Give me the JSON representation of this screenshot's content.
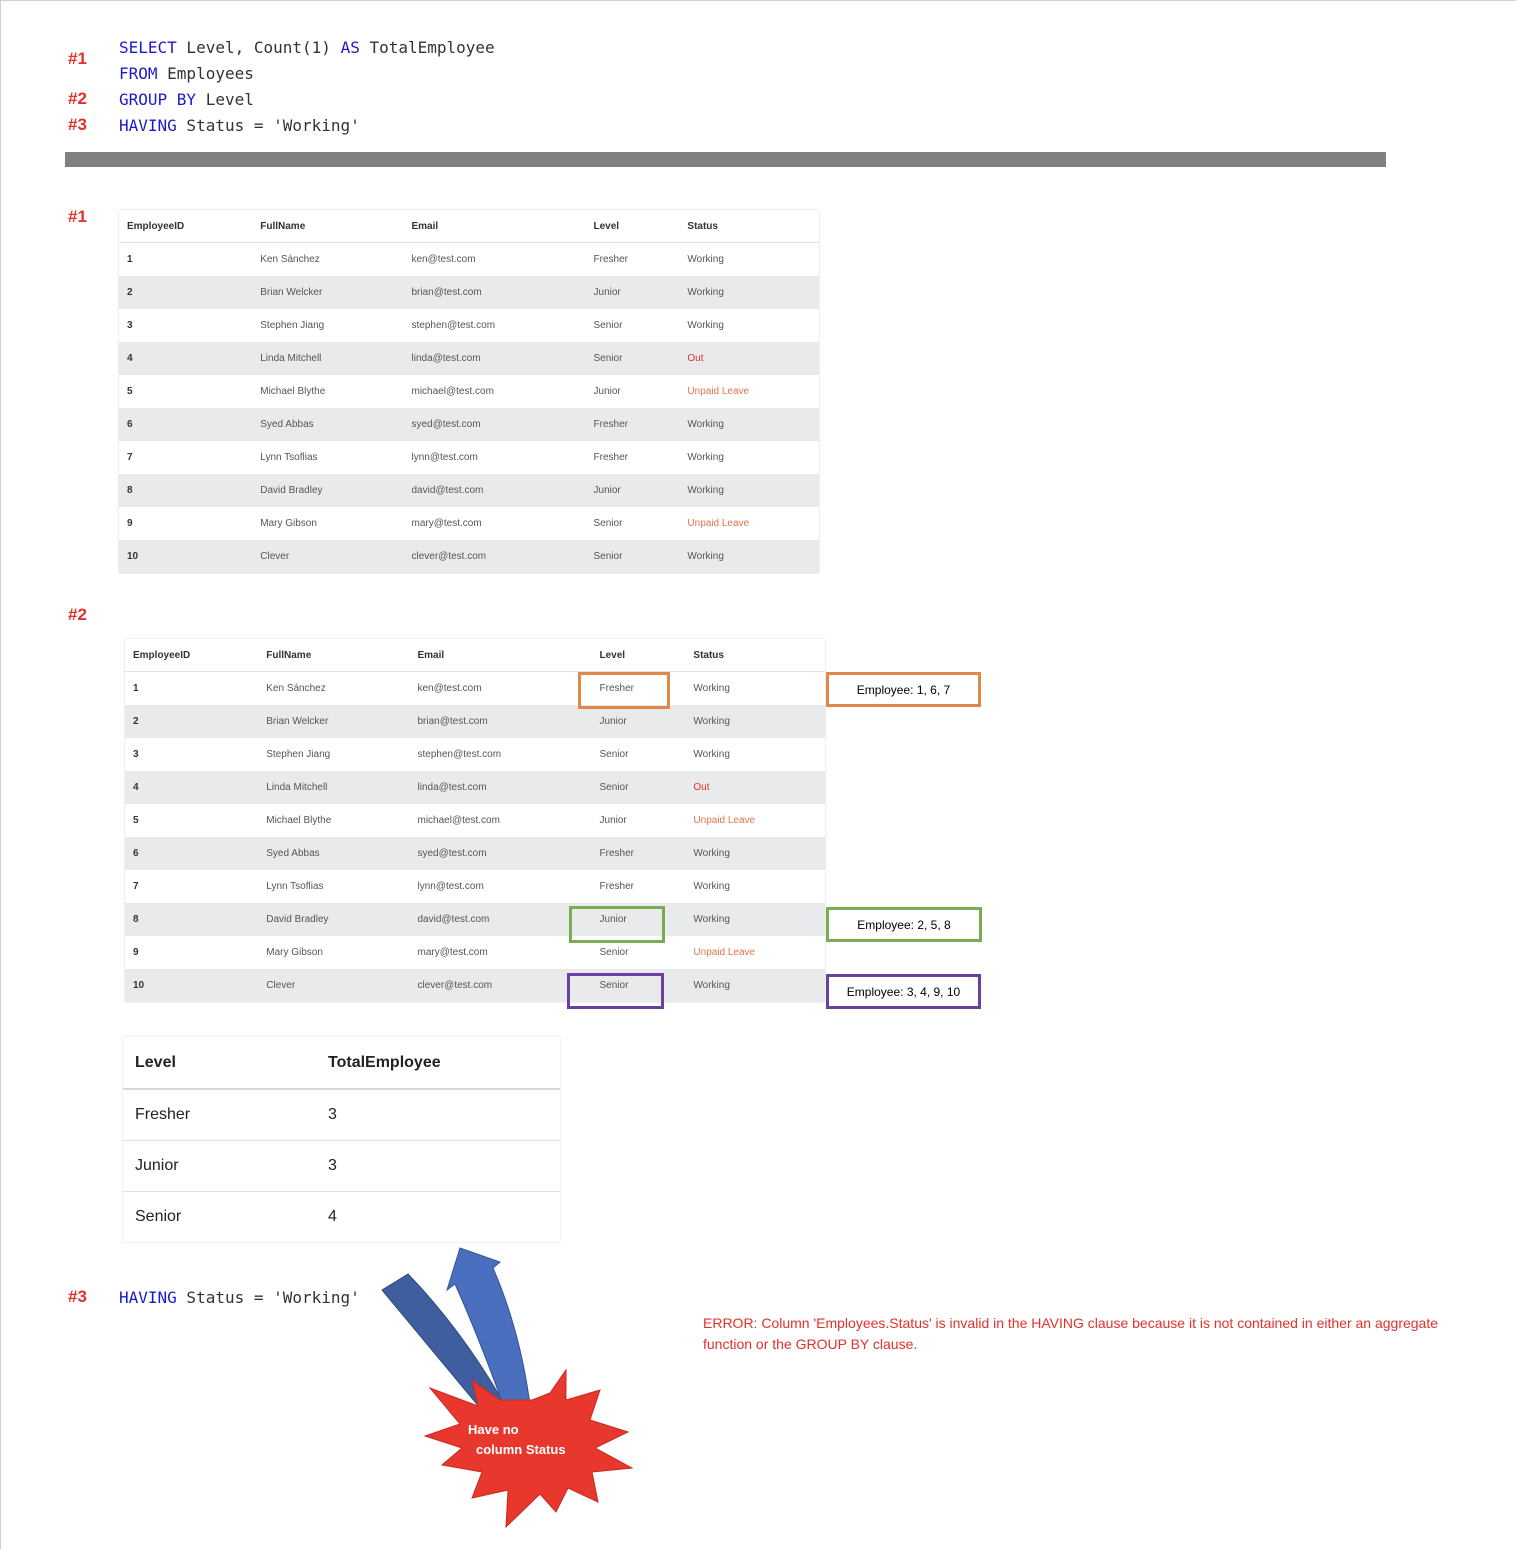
{
  "step_labels": {
    "s1": "#1",
    "s2": "#2",
    "s3": "#3"
  },
  "query": {
    "line1": {
      "kw1": "SELECT",
      "t1": " Level, Count(1) ",
      "kw2": "AS",
      "t2": " TotalEmployee"
    },
    "line2": {
      "kw": "FROM",
      "t": " Employees"
    },
    "line3": {
      "kw": "GROUP BY",
      "t": " Level"
    },
    "line4": {
      "kw": "HAVING",
      "t": " Status = 'Working'"
    }
  },
  "employees": {
    "headers": [
      "EmployeeID",
      "FullName",
      "Email",
      "Level",
      "Status"
    ],
    "rows": [
      [
        "1",
        "Ken Sánchez",
        "ken@test.com",
        "Fresher",
        "Working"
      ],
      [
        "2",
        "Brian Welcker",
        "brian@test.com",
        "Junior",
        "Working"
      ],
      [
        "3",
        "Stephen Jiang",
        "stephen@test.com",
        "Senior",
        "Working"
      ],
      [
        "4",
        "Linda Mitchell",
        "linda@test.com",
        "Senior",
        "Out"
      ],
      [
        "5",
        "Michael Blythe",
        "michael@test.com",
        "Junior",
        "Unpaid Leave"
      ],
      [
        "6",
        "Syed Abbas",
        "syed@test.com",
        "Fresher",
        "Working"
      ],
      [
        "7",
        "Lynn Tsoflias",
        "lynn@test.com",
        "Fresher",
        "Working"
      ],
      [
        "8",
        "David Bradley",
        "david@test.com",
        "Junior",
        "Working"
      ],
      [
        "9",
        "Mary Gibson",
        "mary@test.com",
        "Senior",
        "Unpaid Leave"
      ],
      [
        "10",
        "Clever",
        "clever@test.com",
        "Senior",
        "Working"
      ]
    ]
  },
  "group_notes": {
    "fresher": "Employee: 1, 6, 7",
    "junior": "Employee: 2, 5, 8",
    "senior": "Employee: 3, 4, 9, 10"
  },
  "result": {
    "headers": [
      "Level",
      "TotalEmployee"
    ],
    "rows": [
      [
        "Fresher",
        "3"
      ],
      [
        "Junior",
        "3"
      ],
      [
        "Senior",
        "4"
      ]
    ]
  },
  "having_line": {
    "kw": "HAVING",
    "t": " Status = 'Working'"
  },
  "error_message": "ERROR: Column 'Employees.Status' is invalid in the HAVING clause because it is not contained in either an aggregate function or the GROUP BY clause.",
  "callout": {
    "line1": "Have no",
    "line2": "column Status"
  },
  "colors": {
    "fresher": "#e2874a",
    "junior": "#7cab55",
    "senior": "#6a3fa0",
    "error": "#e0322b",
    "arrow": "#4a6fbf",
    "burst": "#e8372c"
  }
}
